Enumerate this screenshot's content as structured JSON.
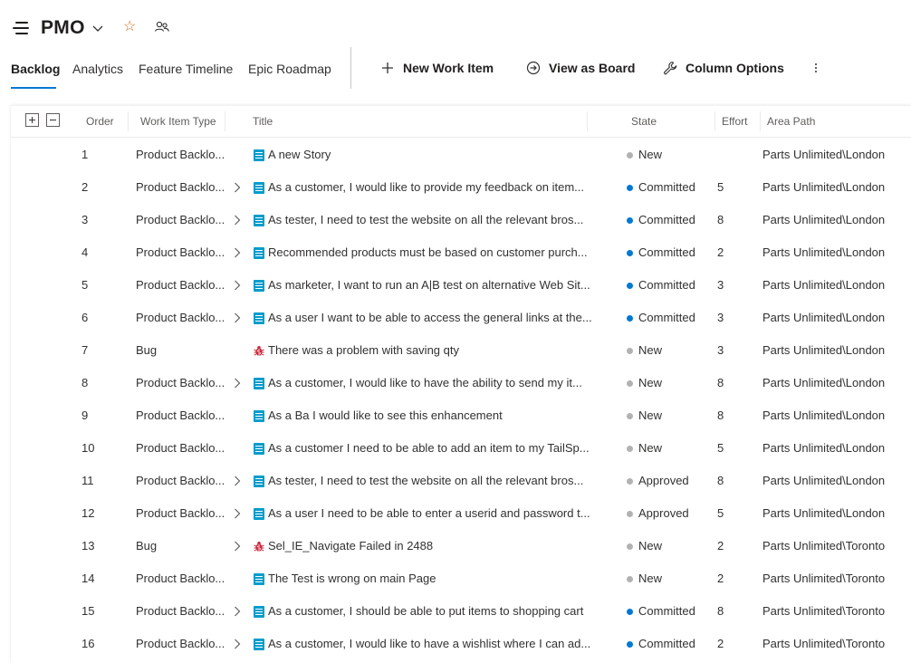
{
  "header": {
    "team_name": "PMO"
  },
  "tabs": [
    {
      "label": "Backlog",
      "active": true
    },
    {
      "label": "Analytics",
      "active": false
    },
    {
      "label": "Feature Timeline",
      "active": false
    },
    {
      "label": "Epic Roadmap",
      "active": false
    }
  ],
  "commands": {
    "new_work_item": "New Work Item",
    "view_as_board": "View as Board",
    "column_options": "Column Options"
  },
  "grid": {
    "columns": [
      "Order",
      "Work Item Type",
      "Title",
      "State",
      "Effort",
      "Area Path"
    ],
    "rows": [
      {
        "order": "1",
        "type": "Product Backlo...",
        "has_children": false,
        "icon": "story-icon",
        "title": "A new Story",
        "state": "New",
        "effort": "",
        "area": "Parts Unlimited\\London"
      },
      {
        "order": "2",
        "type": "Product Backlo...",
        "has_children": true,
        "icon": "story-icon",
        "title": "As a customer, I would like to provide my feedback on item...",
        "state": "Committed",
        "effort": "5",
        "area": "Parts Unlimited\\London"
      },
      {
        "order": "3",
        "type": "Product Backlo...",
        "has_children": true,
        "icon": "story-icon",
        "title": "As tester, I need to test the website on all the relevant bros...",
        "state": "Committed",
        "effort": "8",
        "area": "Parts Unlimited\\London"
      },
      {
        "order": "4",
        "type": "Product Backlo...",
        "has_children": true,
        "icon": "story-icon",
        "title": "Recommended products must be based on customer purch...",
        "state": "Committed",
        "effort": "2",
        "area": "Parts Unlimited\\London"
      },
      {
        "order": "5",
        "type": "Product Backlo...",
        "has_children": true,
        "icon": "story-icon",
        "title": "As marketer, I want to run an A|B test on alternative Web Sit...",
        "state": "Committed",
        "effort": "3",
        "area": "Parts Unlimited\\London"
      },
      {
        "order": "6",
        "type": "Product Backlo...",
        "has_children": true,
        "icon": "story-icon",
        "title": "As a user I want to be able to access the general links at the...",
        "state": "Committed",
        "effort": "3",
        "area": "Parts Unlimited\\London"
      },
      {
        "order": "7",
        "type": "Bug",
        "has_children": false,
        "icon": "bug-icon",
        "title": "There was a problem with saving qty",
        "state": "New",
        "effort": "3",
        "area": "Parts Unlimited\\London"
      },
      {
        "order": "8",
        "type": "Product Backlo...",
        "has_children": true,
        "icon": "story-icon",
        "title": "As a customer, I would like to have the ability to send my it...",
        "state": "New",
        "effort": "8",
        "area": "Parts Unlimited\\London"
      },
      {
        "order": "9",
        "type": "Product Backlo...",
        "has_children": false,
        "icon": "story-icon",
        "title": "As a Ba I would like to see this enhancement",
        "state": "New",
        "effort": "8",
        "area": "Parts Unlimited\\London"
      },
      {
        "order": "10",
        "type": "Product Backlo...",
        "has_children": false,
        "icon": "story-icon",
        "title": "As a customer I need to be able to add an item to my TailSp...",
        "state": "New",
        "effort": "5",
        "area": "Parts Unlimited\\London"
      },
      {
        "order": "11",
        "type": "Product Backlo...",
        "has_children": true,
        "icon": "story-icon",
        "title": "As tester, I need to test the website on all the relevant bros...",
        "state": "Approved",
        "effort": "8",
        "area": "Parts Unlimited\\London"
      },
      {
        "order": "12",
        "type": "Product Backlo...",
        "has_children": true,
        "icon": "story-icon",
        "title": "As a user I need to be able to enter a userid and password t...",
        "state": "Approved",
        "effort": "5",
        "area": "Parts Unlimited\\London"
      },
      {
        "order": "13",
        "type": "Bug",
        "has_children": true,
        "icon": "bug-icon",
        "title": "Sel_IE_Navigate Failed in 2488",
        "state": "New",
        "effort": "2",
        "area": "Parts Unlimited\\Toronto"
      },
      {
        "order": "14",
        "type": "Product Backlo...",
        "has_children": false,
        "icon": "story-icon",
        "title": "The Test is wrong on main Page",
        "state": "New",
        "effort": "2",
        "area": "Parts Unlimited\\Toronto"
      },
      {
        "order": "15",
        "type": "Product Backlo...",
        "has_children": true,
        "icon": "story-icon",
        "title": "As a customer, I should be able to put items to shopping cart",
        "state": "Committed",
        "effort": "8",
        "area": "Parts Unlimited\\Toronto"
      },
      {
        "order": "16",
        "type": "Product Backlo...",
        "has_children": true,
        "icon": "story-icon",
        "title": "As a customer, I would like to have a wishlist where I can ad...",
        "state": "Committed",
        "effort": "2",
        "area": "Parts Unlimited\\Toronto"
      }
    ]
  },
  "colors": {
    "accent": "#0078d4",
    "state_new": "#b2b2b2",
    "state_committed": "#0078d4",
    "state_approved": "#b2b2b2",
    "story": "#009ccc",
    "bug": "#cc293d",
    "favorite": "#d86e1a"
  }
}
